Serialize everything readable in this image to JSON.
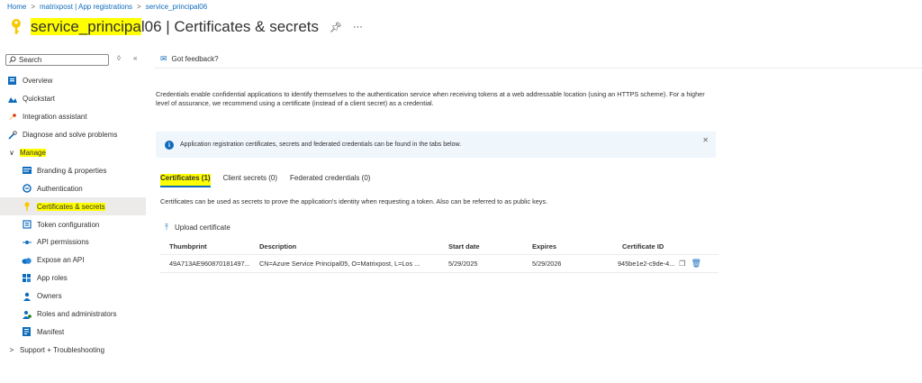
{
  "breadcrumb": [
    "Home",
    "matrixpost | App registrations",
    "service_principal06"
  ],
  "header": {
    "title_highlight": "service_principa",
    "title_rest": "l06",
    "title_suffix": " | Certificates & secrets"
  },
  "sidebar": {
    "search_placeholder": "Search",
    "items": [
      {
        "label": "Overview",
        "icon": "overview-icon"
      },
      {
        "label": "Quickstart",
        "icon": "quickstart-icon"
      },
      {
        "label": "Integration assistant",
        "icon": "rocket-icon"
      },
      {
        "label": "Diagnose and solve problems",
        "icon": "wrench-icon"
      },
      {
        "label": "Manage",
        "icon": "chevron-down-icon"
      },
      {
        "label": "Branding & properties",
        "icon": "branding-icon"
      },
      {
        "label": "Authentication",
        "icon": "authentication-icon"
      },
      {
        "label": "Certificates & secrets",
        "icon": "key-icon"
      },
      {
        "label": "Token configuration",
        "icon": "token-icon"
      },
      {
        "label": "API permissions",
        "icon": "api-permissions-icon"
      },
      {
        "label": "Expose an API",
        "icon": "cloud-icon"
      },
      {
        "label": "App roles",
        "icon": "app-roles-icon"
      },
      {
        "label": "Owners",
        "icon": "owners-icon"
      },
      {
        "label": "Roles and administrators",
        "icon": "roles-icon"
      },
      {
        "label": "Manifest",
        "icon": "manifest-icon"
      },
      {
        "label": "Support + Troubleshooting",
        "icon": "chevron-right-icon"
      }
    ]
  },
  "toolbar": {
    "feedback_label": "Got feedback?"
  },
  "main": {
    "description": "Credentials enable confidential applications to identify themselves to the authentication service when receiving tokens at a web addressable location (using an HTTPS scheme). For a higher level of assurance, we recommend using a certificate (instead of a client secret) as a credential.",
    "info_text": "Application registration certificates, secrets and federated credentials can be found in the tabs below.",
    "tabs": [
      "Certificates (1)",
      "Client secrets (0)",
      "Federated credentials (0)"
    ],
    "tab_description": "Certificates can be used as secrets to prove the application's identity when requesting a token. Also can be referred to as public keys.",
    "upload_label": "Upload certificate",
    "table": {
      "headers": [
        "Thumbprint",
        "Description",
        "Start date",
        "Expires",
        "Certificate ID"
      ],
      "rows": [
        [
          "49A713AE960870181497...",
          "CN=Azure Service Principal05, O=Matrixpost, L=Los ...",
          "5/29/2025",
          "5/29/2026",
          "945be1e2-c9de-4..."
        ]
      ]
    }
  },
  "colors": {
    "accent": "#0f6cbd",
    "highlight": "#ffff00",
    "selected": "#edebe9",
    "info_bg": "#eff6fc"
  }
}
